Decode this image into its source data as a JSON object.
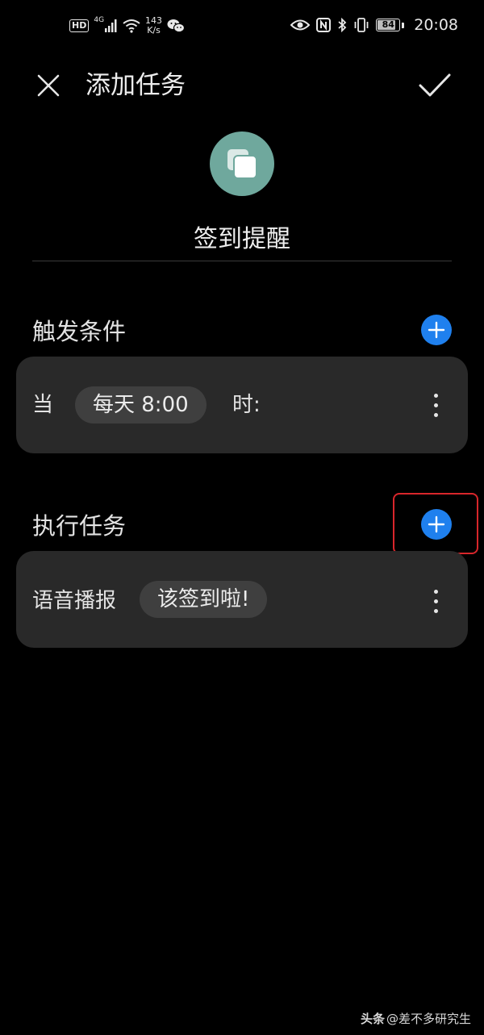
{
  "status_bar": {
    "hd": "HD",
    "network_type": "4G",
    "speed_value": "143",
    "speed_unit": "K/s",
    "battery": "84",
    "battery_level": 0.84,
    "time": "20:08",
    "icons": [
      "signal-icon",
      "wifi-icon",
      "wechat-icon",
      "eye-icon",
      "nfc-icon",
      "bluetooth-icon",
      "vibrate-icon",
      "battery-icon"
    ]
  },
  "header": {
    "title": "添加任务",
    "close_icon": "close-icon",
    "confirm_icon": "check-icon"
  },
  "task": {
    "icon": "copy-icon",
    "icon_color": "#6fa89d",
    "name": "签到提醒"
  },
  "trigger": {
    "title": "触发条件",
    "prefix": "当",
    "condition": "每天 8:00",
    "suffix": "时:"
  },
  "action": {
    "title": "执行任务",
    "label": "语音播报",
    "value": "该签到啦!"
  },
  "accent_color": "#1f80ee",
  "highlight_color": "#d8262b",
  "watermark": {
    "brand": "头条",
    "handle": "@差不多研究生"
  }
}
